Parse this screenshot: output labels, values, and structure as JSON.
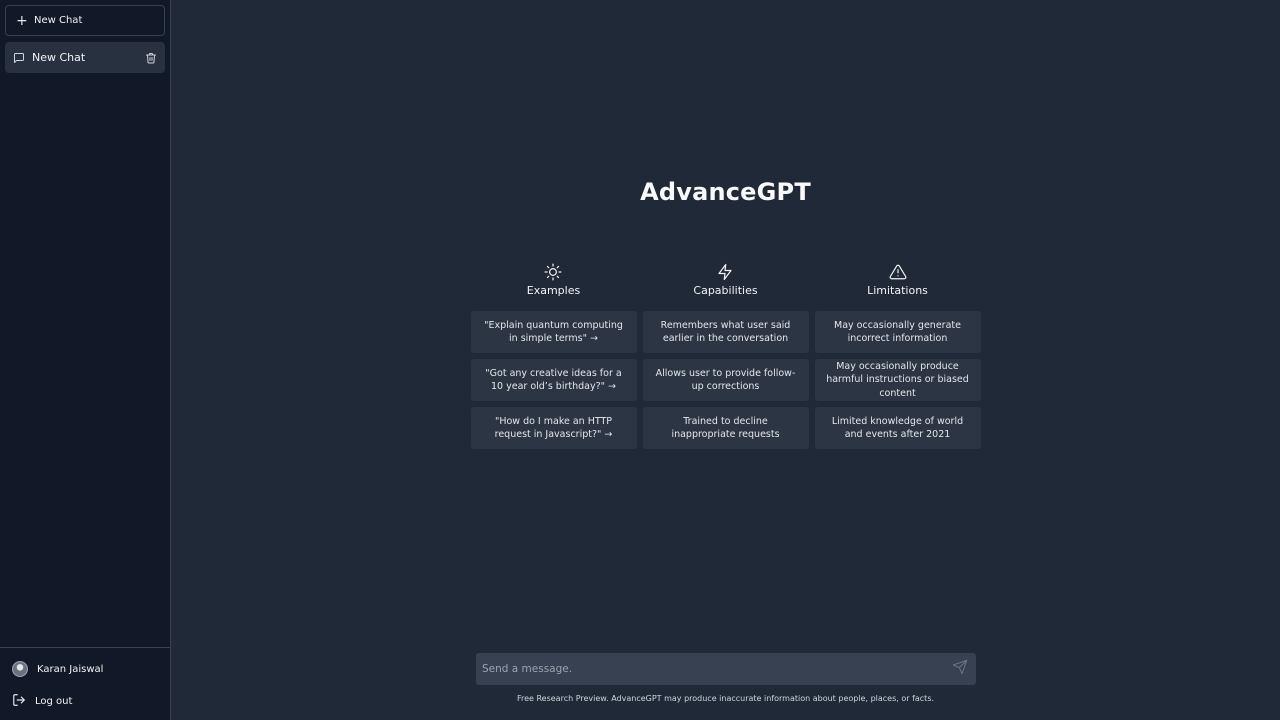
{
  "sidebar": {
    "new_chat_label": "New Chat",
    "chats": [
      {
        "title": "New Chat"
      }
    ],
    "user_name": "Karan Jaiswal",
    "logout_label": "Log out"
  },
  "main": {
    "app_title": "AdvanceGPT",
    "columns": [
      {
        "icon": "sun-icon",
        "title": "Examples",
        "items": [
          "\"Explain quantum computing in simple terms\" →",
          "\"Got any creative ideas for a 10 year old’s birthday?\" →",
          "\"How do I make an HTTP request in Javascript?\" →"
        ]
      },
      {
        "icon": "lightning-icon",
        "title": "Capabilities",
        "items": [
          "Remembers what user said earlier in the conversation",
          "Allows user to provide follow-up corrections",
          "Trained to decline inappropriate requests"
        ]
      },
      {
        "icon": "warning-icon",
        "title": "Limitations",
        "items": [
          "May occasionally generate incorrect information",
          "May occasionally produce harmful instructions or biased content",
          "Limited knowledge of world and events after 2021"
        ]
      }
    ],
    "composer": {
      "placeholder": "Send a message.",
      "value": ""
    },
    "disclaimer": "Free Research Preview. AdvanceGPT may produce inaccurate information about people, places, or facts."
  },
  "colors": {
    "sidebar_bg": "#111827",
    "main_bg": "#1f2937",
    "card_bg": "#2b3544",
    "input_bg": "#374151"
  }
}
